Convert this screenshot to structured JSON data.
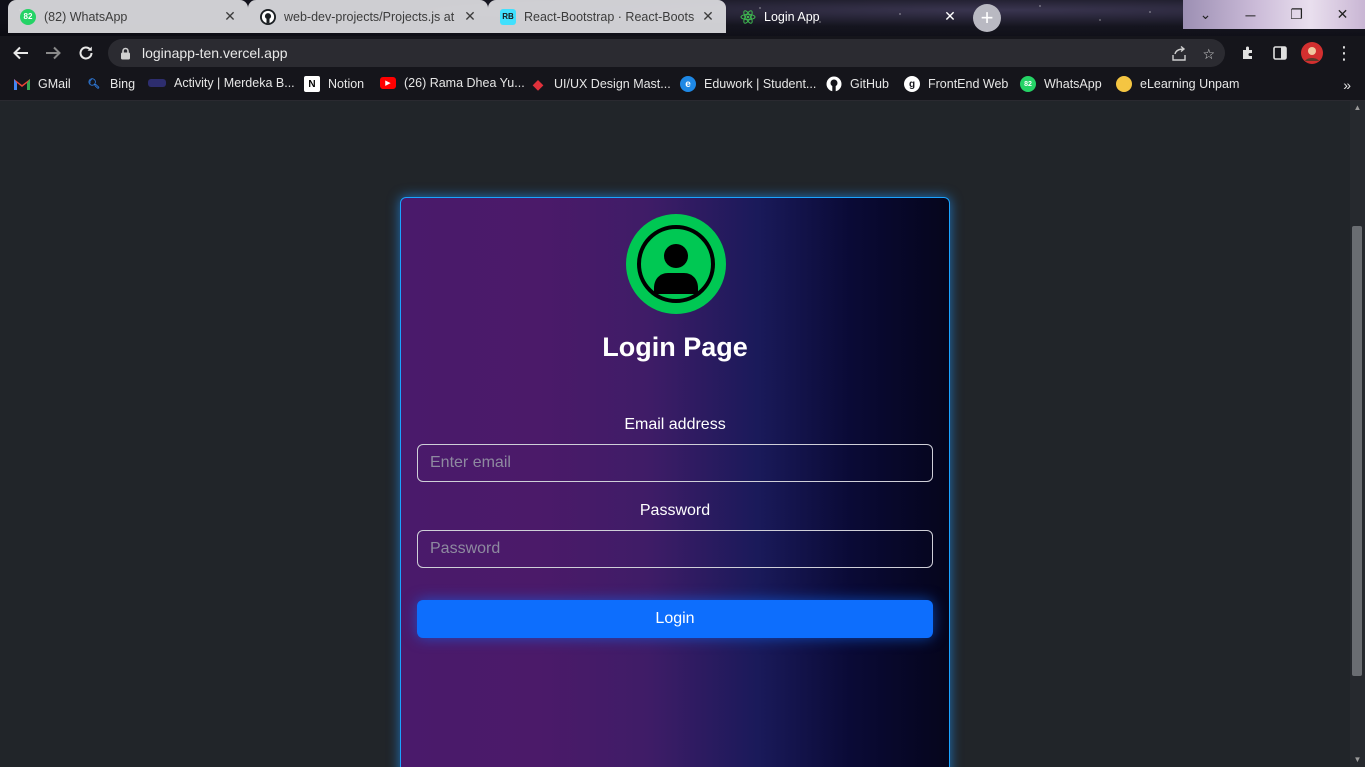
{
  "browser": {
    "tabs": [
      {
        "label": "(82) WhatsApp",
        "icon": "whatsapp-icon",
        "badge": "82",
        "active": false
      },
      {
        "label": "web-dev-projects/Projects.js at m",
        "icon": "github-icon",
        "active": false
      },
      {
        "label": "React-Bootstrap · React-Bootstra",
        "icon": "react-bootstrap-icon",
        "active": false
      },
      {
        "label": "Login App",
        "icon": "react-icon",
        "active": true
      }
    ],
    "new_tab_label": "+",
    "url": "loginapp-ten.vercel.app",
    "bookmarks": [
      {
        "label": "GMail",
        "icon": "gmail-icon"
      },
      {
        "label": "Bing",
        "icon": "bing-icon"
      },
      {
        "label": "Activity | Merdeka B...",
        "icon": "merdeka-icon"
      },
      {
        "label": "Notion",
        "icon": "notion-icon"
      },
      {
        "label": "(26) Rama Dhea Yu...",
        "icon": "youtube-icon"
      },
      {
        "label": "UI/UX Design Mast...",
        "icon": "ruby-icon"
      },
      {
        "label": "Eduwork | Student...",
        "icon": "eduwork-icon"
      },
      {
        "label": "GitHub",
        "icon": "github-icon"
      },
      {
        "label": "FrontEnd Web",
        "icon": "frontend-icon"
      },
      {
        "label": "WhatsApp",
        "icon": "whatsapp-icon",
        "badge": "82"
      },
      {
        "label": "eLearning Unpam",
        "icon": "elearning-icon"
      }
    ],
    "bookmarks_overflow": "»"
  },
  "login": {
    "title": "Login Page",
    "email_label": "Email address",
    "email_placeholder": "Enter email",
    "email_value": "",
    "password_label": "Password",
    "password_placeholder": "Password",
    "password_value": "",
    "submit_label": "Login"
  },
  "colors": {
    "accent": "#0d6efd",
    "avatar": "#00c853",
    "card_border": "#1aa3ff",
    "page_bg": "#212529"
  }
}
